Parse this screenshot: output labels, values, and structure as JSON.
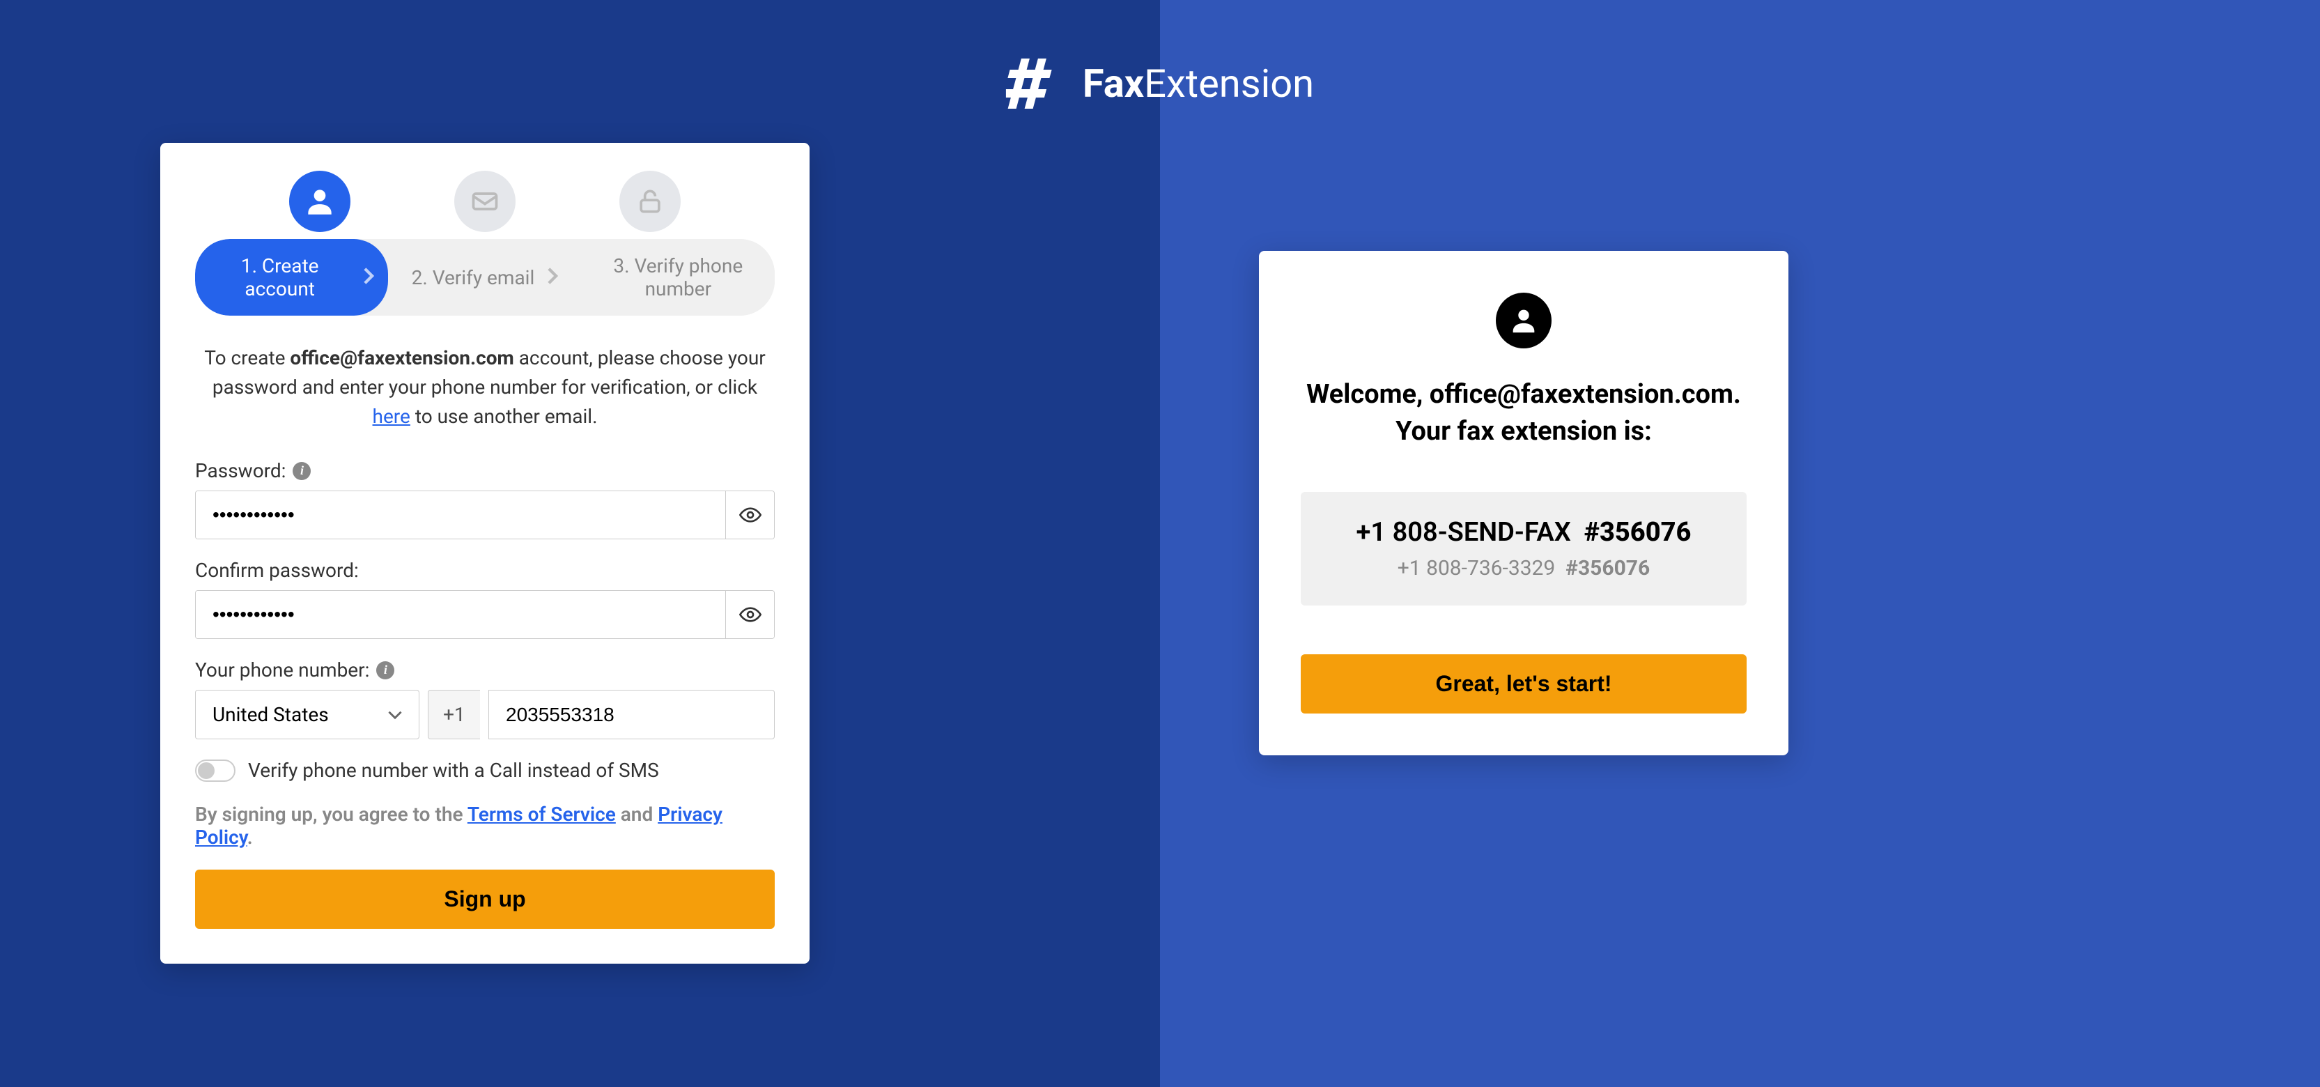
{
  "logo": {
    "brand_bold": "Fax",
    "brand_rest": "Extension"
  },
  "signup": {
    "steps": {
      "step1": "1. Create account",
      "step2": "2. Verify email",
      "step3": "3. Verify phone number"
    },
    "instruction": {
      "prefix": "To create ",
      "email": "office@faxextension.com",
      "middle": " account, please choose your password and enter your phone number for verification, or click ",
      "here": "here",
      "suffix": " to use another email."
    },
    "password_label": "Password:",
    "password_value": "••••••••••••",
    "confirm_label": "Confirm password:",
    "confirm_value": "••••••••••••",
    "phone_label": "Your phone number:",
    "country": "United States",
    "country_code": "+1",
    "phone_value": "2035553318",
    "toggle_label": "Verify phone number with a Call instead of SMS",
    "terms": {
      "prefix": "By signing up, you agree to the ",
      "tos": "Terms of Service",
      "and": " and ",
      "privacy": "Privacy Policy",
      "period": "."
    },
    "signup_button": "Sign up"
  },
  "welcome": {
    "heading_line1": "Welcome, office@faxextension.com.",
    "heading_line2": "Your fax extension is:",
    "fax_display": {
      "vanity_number": "+1 808-SEND-FAX",
      "vanity_ext": "#356076",
      "numeric_number": "+1 808-736-3329",
      "numeric_ext": "#356076"
    },
    "start_button": "Great, let's start!"
  }
}
